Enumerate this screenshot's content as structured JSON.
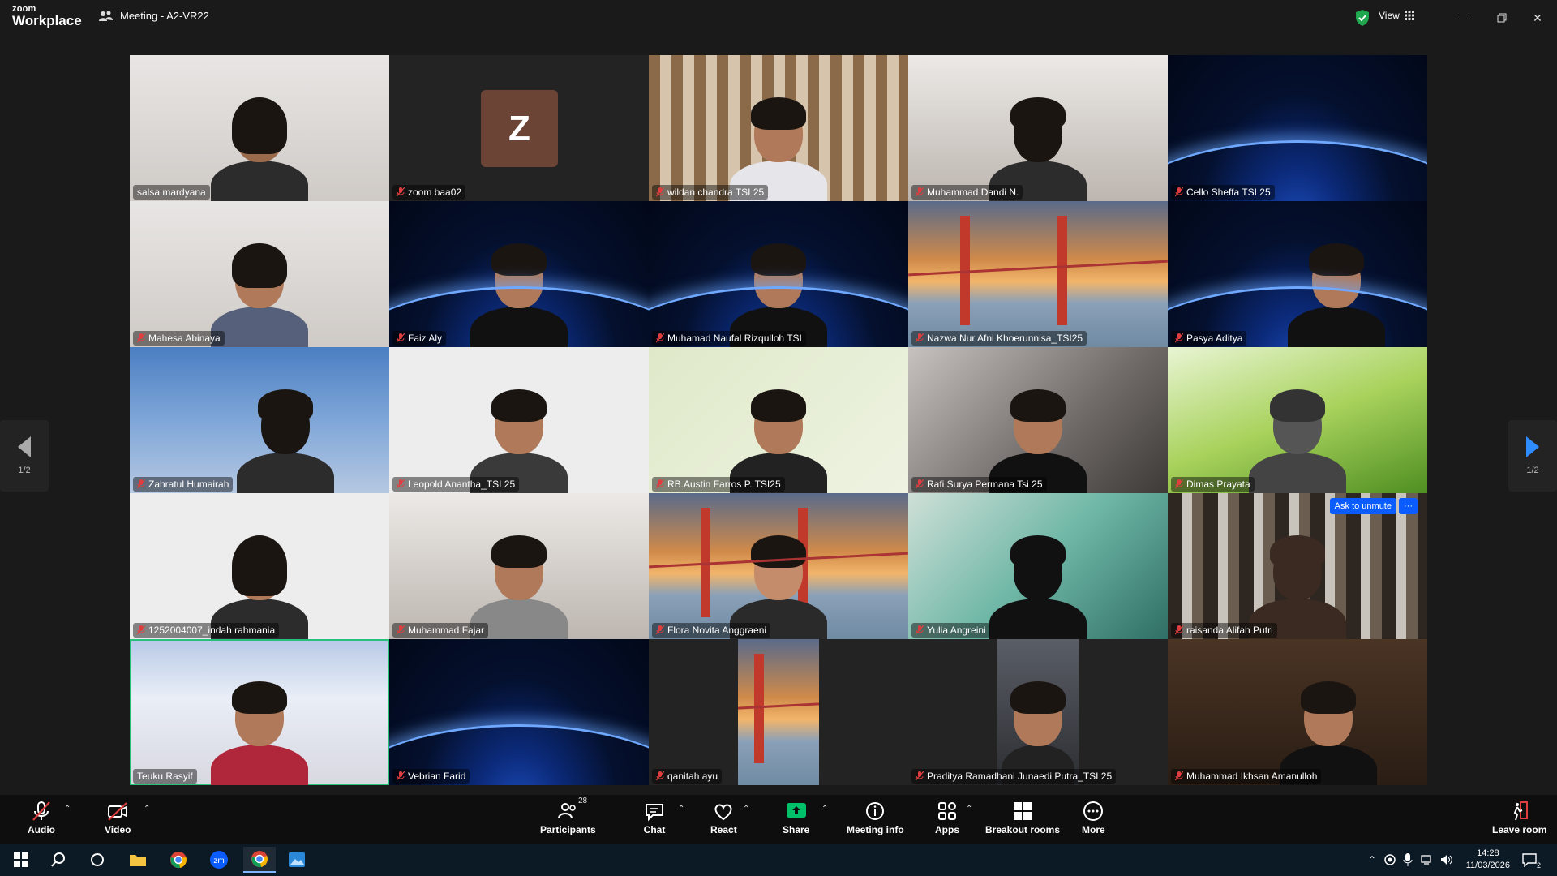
{
  "app": {
    "logo_line1": "zoom",
    "logo_line2": "Workplace",
    "meeting_title": "Meeting - A2-VR22",
    "view_label": "View",
    "accent": "#0b5cff",
    "active_speaker_color": "#27c07d"
  },
  "gallery": {
    "page_label_left": "1/2",
    "page_label_right": "1/2",
    "ask_unmute_label": "Ask to unmute",
    "more_label": "···",
    "avatar_letter": "Z",
    "participants": [
      {
        "name": "salsa mardyana",
        "muted": false
      },
      {
        "name": "zoom baa02",
        "muted": true
      },
      {
        "name": "wildan chandra TSI 25",
        "muted": true
      },
      {
        "name": "Muhammad Dandi N.",
        "muted": true
      },
      {
        "name": "Cello Sheffa TSI 25",
        "muted": true
      },
      {
        "name": "Mahesa Abinaya",
        "muted": true
      },
      {
        "name": "Faiz Aly",
        "muted": true
      },
      {
        "name": "Muhamad Naufal Rizqulloh TSI",
        "muted": true
      },
      {
        "name": "Nazwa Nur Afni Khoerunnisa_TSI25",
        "muted": true
      },
      {
        "name": "Pasya Aditya",
        "muted": true
      },
      {
        "name": "Zahratul Humairah",
        "muted": true
      },
      {
        "name": "Leopold Anantha_TSI 25",
        "muted": true
      },
      {
        "name": "RB.Austin Farros P. TSI25",
        "muted": true
      },
      {
        "name": "Rafi Surya Permana Tsi 25",
        "muted": true
      },
      {
        "name": "Dimas Prayata",
        "muted": true
      },
      {
        "name": "1252004007_indah rahmania",
        "muted": true
      },
      {
        "name": "Muhammad Fajar",
        "muted": true
      },
      {
        "name": "Flora Novita Anggraeni",
        "muted": true
      },
      {
        "name": "Yulia Angreini",
        "muted": true
      },
      {
        "name": "raisanda Alifah Putri",
        "muted": true
      },
      {
        "name": "Teuku Rasyif",
        "muted": false
      },
      {
        "name": "Vebrian Farid",
        "muted": true
      },
      {
        "name": "qanitah ayu",
        "muted": true
      },
      {
        "name": "Praditya Ramadhani Junaedi Putra_TSI 25",
        "muted": true
      },
      {
        "name": "Muhammad Ikhsan Amanulloh",
        "muted": true
      }
    ]
  },
  "toolbar": {
    "audio": "Audio",
    "video": "Video",
    "participants": "Participants",
    "participants_count": "28",
    "chat": "Chat",
    "react": "React",
    "share": "Share",
    "meeting_info": "Meeting info",
    "apps": "Apps",
    "breakout": "Breakout rooms",
    "more": "More",
    "leave": "Leave room",
    "share_color": "#00c16a"
  },
  "taskbar": {
    "time": "14:28",
    "date": "11/03/2026",
    "notif_count": "2"
  }
}
